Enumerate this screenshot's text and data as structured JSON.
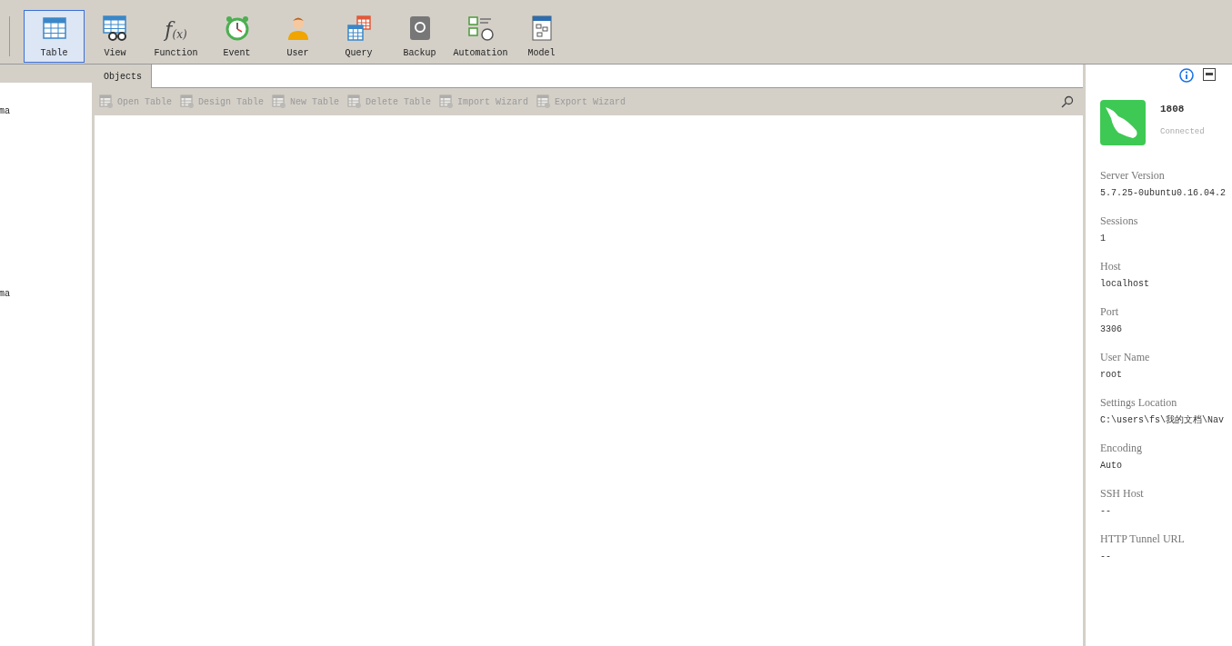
{
  "toolbar": [
    {
      "label": "Table",
      "selected": true
    },
    {
      "label": "View",
      "selected": false
    },
    {
      "label": "Function",
      "selected": false,
      "glyph": "f",
      "glyph_sub": "(x)"
    },
    {
      "label": "Event",
      "selected": false
    },
    {
      "label": "User",
      "selected": false
    },
    {
      "label": "Query",
      "selected": false
    },
    {
      "label": "Backup",
      "selected": false
    },
    {
      "label": "Automation",
      "selected": false
    },
    {
      "label": "Model",
      "selected": false
    }
  ],
  "sidebar": {
    "items": [
      "ma",
      "ma"
    ]
  },
  "tabs": [
    {
      "label": "Objects",
      "selected": true
    }
  ],
  "object_toolbar": [
    {
      "label": "Open Table",
      "disabled": true
    },
    {
      "label": "Design Table",
      "disabled": true
    },
    {
      "label": "New Table",
      "disabled": true
    },
    {
      "label": "Delete Table",
      "disabled": true
    },
    {
      "label": "Import Wizard",
      "disabled": true
    },
    {
      "label": "Export Wizard",
      "disabled": true
    }
  ],
  "connection": {
    "name": "1808",
    "status": "Connected"
  },
  "info_fields": [
    {
      "label": "Server Version",
      "value": "5.7.25-0ubuntu0.16.04.2"
    },
    {
      "label": "Sessions",
      "value": "1"
    },
    {
      "label": "Host",
      "value": "localhost"
    },
    {
      "label": "Port",
      "value": "3306"
    },
    {
      "label": "User Name",
      "value": "root"
    },
    {
      "label": "Settings Location",
      "value": "C:\\users\\fs\\我的文档\\Nav"
    },
    {
      "label": "Encoding",
      "value": "Auto"
    },
    {
      "label": "SSH Host",
      "value": "--"
    },
    {
      "label": "HTTP Tunnel URL",
      "value": "--"
    }
  ]
}
